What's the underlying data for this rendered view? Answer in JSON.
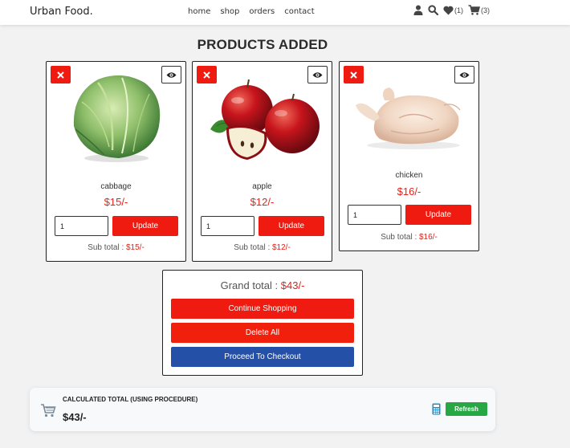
{
  "header": {
    "logo": "Urban Food.",
    "nav": [
      "home",
      "shop",
      "orders",
      "contact"
    ],
    "wishlist_count": "(1)",
    "cart_count": "(3)"
  },
  "page_title": "PRODUCTS ADDED",
  "products": [
    {
      "name": "cabbage",
      "price": "$15/-",
      "qty": "1",
      "update_label": "Update",
      "subtotal_label": "Sub total :",
      "subtotal": "$15/-",
      "image": "cabbage"
    },
    {
      "name": "apple",
      "price": "$12/-",
      "qty": "1",
      "update_label": "Update",
      "subtotal_label": "Sub total :",
      "subtotal": "$12/-",
      "image": "apple"
    },
    {
      "name": "chicken",
      "price": "$16/-",
      "qty": "1",
      "update_label": "Update",
      "subtotal_label": "Sub total :",
      "subtotal": "$16/-",
      "image": "chicken"
    }
  ],
  "grand_total": {
    "label": "Grand total :",
    "amount": "$43/-",
    "continue_label": "Continue Shopping",
    "delete_label": "Delete All",
    "checkout_label": "Proceed To Checkout"
  },
  "calculated": {
    "title": "CALCULATED TOTAL (USING PROCEDURE)",
    "value": "$43/-",
    "refresh_label": "Refresh"
  },
  "colors": {
    "accent_red": "#f01b10",
    "price_red": "#e32219",
    "delete_red": "#f0200d",
    "checkout_blue": "#2450a8",
    "refresh_green": "#28a745"
  }
}
